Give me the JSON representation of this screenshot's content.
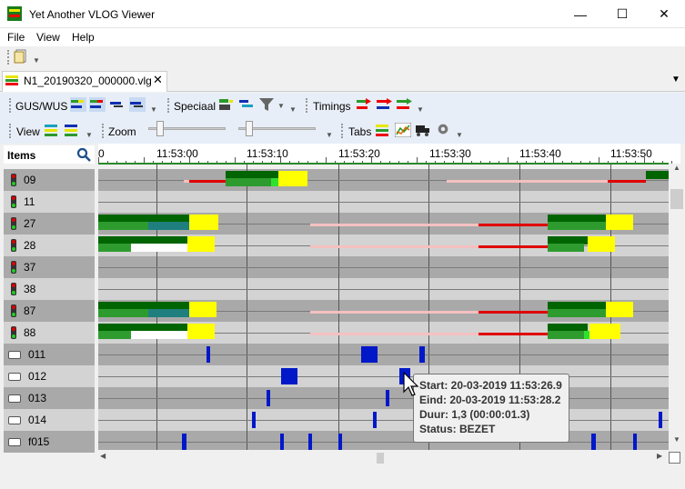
{
  "window": {
    "title": "Yet Another VLOG Viewer"
  },
  "menu": [
    "File",
    "View",
    "Help"
  ],
  "tab": {
    "label": "N1_20190320_000000.vlg",
    "close": "✕"
  },
  "toolbar": {
    "group1": "GUS/WUS",
    "group2": "Speciaal",
    "group3": "Timings",
    "group4": "View",
    "group5": "Zoom",
    "group6": "Tabs"
  },
  "items_panel": {
    "header": "Items",
    "rows": [
      {
        "label": "09",
        "kind": "signal"
      },
      {
        "label": "11",
        "kind": "signal"
      },
      {
        "label": "27",
        "kind": "signal"
      },
      {
        "label": "28",
        "kind": "signal"
      },
      {
        "label": "37",
        "kind": "signal"
      },
      {
        "label": "38",
        "kind": "signal"
      },
      {
        "label": "87",
        "kind": "signal"
      },
      {
        "label": "88",
        "kind": "signal"
      },
      {
        "label": "011",
        "kind": "detector"
      },
      {
        "label": "012",
        "kind": "detector"
      },
      {
        "label": "013",
        "kind": "detector"
      },
      {
        "label": "014",
        "kind": "detector"
      },
      {
        "label": "f015",
        "kind": "detector"
      }
    ]
  },
  "ruler": {
    "labels": [
      "0",
      "11:53:00",
      "11:53:10",
      "11:53:20",
      "11:53:30",
      "11:53:40",
      "11:53:50"
    ]
  },
  "tooltip": {
    "start": "Start: 20-03-2019 11:53:26.9",
    "eind": "Eind: 20-03-2019 11:53:28.2",
    "duur": "Duur: 1,3 (00:00:01.3)",
    "status": "Status: BEZET"
  },
  "colors": {
    "dark_green": "#006400",
    "green": "#2e9b2e",
    "yellow": "#ffff00",
    "red": "#e00000",
    "pink": "#f5c0c0",
    "teal": "#1f7f7f",
    "blue": "#0018c8"
  }
}
